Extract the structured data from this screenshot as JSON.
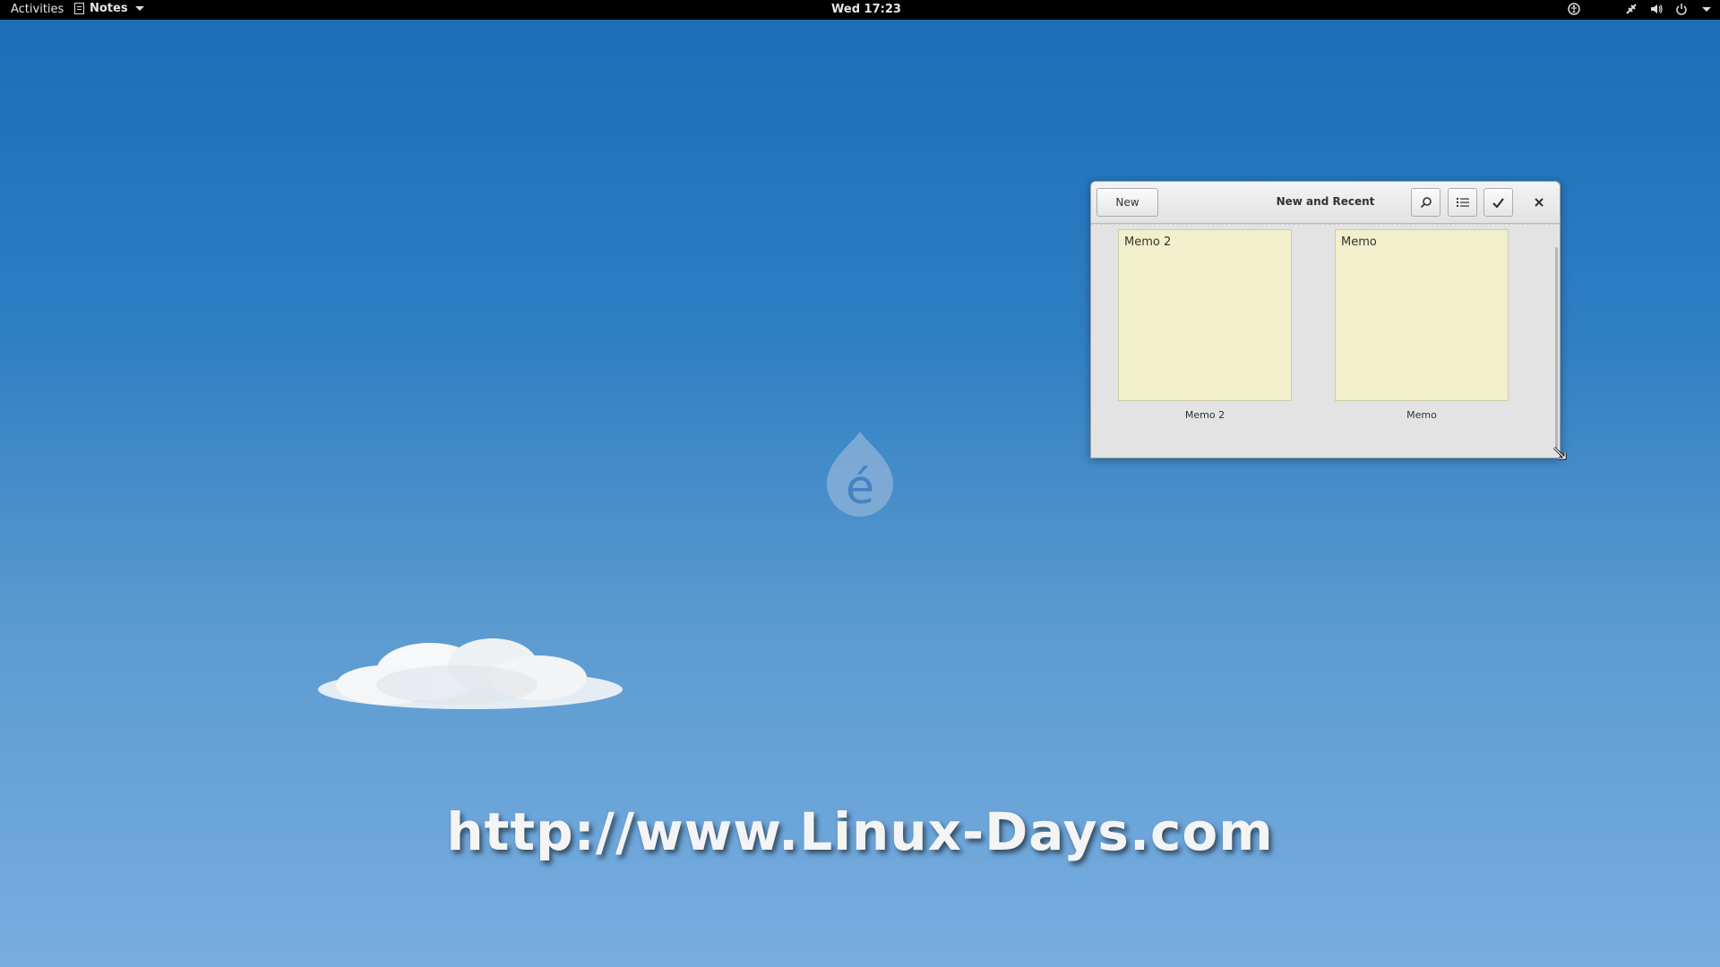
{
  "topbar": {
    "activities": "Activities",
    "app_menu": "Notes",
    "clock": "Wed 17:23"
  },
  "wallpaper": {
    "watermark": "http://www.Linux-Days.com"
  },
  "window": {
    "new_button": "New",
    "title": "New and Recent",
    "notes": [
      {
        "card_text": "Memo 2",
        "caption": "Memo 2"
      },
      {
        "card_text": "Memo",
        "caption": "Memo"
      }
    ]
  },
  "colors": {
    "note_background": "#f2f0cc",
    "topbar": "#000000",
    "wallpaper_top": "#1a6db5"
  },
  "icons": {
    "search": "magnifier-icon",
    "view": "list-view-icon",
    "select": "checkmark-icon",
    "close": "close-icon"
  }
}
